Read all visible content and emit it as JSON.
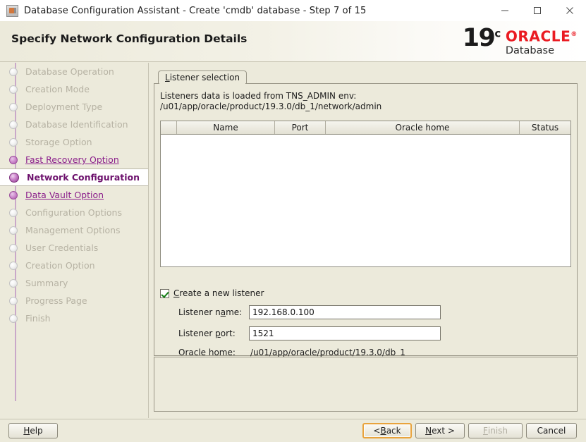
{
  "window": {
    "title": "Database Configuration Assistant - Create 'cmdb' database - Step 7 of 15",
    "icon": "java-app-icon",
    "controls": {
      "minimize": "minimize-icon",
      "maximize": "maximize-icon",
      "close": "close-icon"
    }
  },
  "banner": {
    "title": "Specify Network Configuration Details",
    "brand": {
      "version": "19",
      "version_suffix": "c",
      "product": "ORACLE",
      "trademark": "®",
      "subtitle": "Database",
      "oracle_red": "#ea1b22"
    }
  },
  "sidebar": {
    "steps": [
      {
        "label": "Database Operation",
        "state": "pending"
      },
      {
        "label": "Creation Mode",
        "state": "pending"
      },
      {
        "label": "Deployment Type",
        "state": "pending"
      },
      {
        "label": "Database Identification",
        "state": "pending"
      },
      {
        "label": "Storage Option",
        "state": "pending"
      },
      {
        "label": "Fast Recovery Option",
        "state": "done"
      },
      {
        "label": "Network Configuration",
        "state": "active"
      },
      {
        "label": "Data Vault Option",
        "state": "next"
      },
      {
        "label": "Configuration Options",
        "state": "pending"
      },
      {
        "label": "Management Options",
        "state": "pending"
      },
      {
        "label": "User Credentials",
        "state": "pending"
      },
      {
        "label": "Creation Option",
        "state": "pending"
      },
      {
        "label": "Summary",
        "state": "pending"
      },
      {
        "label": "Progress Page",
        "state": "pending"
      },
      {
        "label": "Finish",
        "state": "pending"
      }
    ],
    "colors": {
      "link": "#8b1f8b",
      "active": "#6d116d",
      "pending": "#b6b2a3"
    }
  },
  "main": {
    "tab": {
      "mnemonic": "L",
      "rest": "istener selection"
    },
    "hint_line1": "Listeners data is loaded from TNS_ADMIN env:",
    "hint_line2": "/u01/app/oracle/product/19.3.0/db_1/network/admin",
    "table": {
      "columns": [
        "",
        "Name",
        "Port",
        "Oracle home",
        "Status"
      ],
      "rows": []
    },
    "create_listener": {
      "checked": true,
      "mnemonic": "C",
      "rest": "reate a new listener"
    },
    "fields": {
      "listener_name": {
        "label_pre": "Listener n",
        "label_mn": "a",
        "label_post": "me:",
        "value": "192.168.0.100"
      },
      "listener_port": {
        "label_pre": "Listener ",
        "label_mn": "p",
        "label_post": "ort:",
        "value": "1521"
      },
      "oracle_home": {
        "label": "Oracle home:",
        "value": "/u01/app/oracle/product/19.3.0/db_1"
      }
    },
    "message_panel": ""
  },
  "buttons": {
    "help": {
      "pre": "",
      "mn": "H",
      "post": "elp",
      "state": "enabled"
    },
    "back": {
      "pre": "< ",
      "mn": "B",
      "post": "ack",
      "state": "focused"
    },
    "next": {
      "pre": "",
      "mn": "N",
      "post": "ext >",
      "state": "enabled"
    },
    "finish": {
      "pre": "",
      "mn": "F",
      "post": "inish",
      "state": "disabled"
    },
    "cancel": {
      "pre": "",
      "mn": "",
      "post": "Cancel",
      "state": "enabled"
    }
  }
}
